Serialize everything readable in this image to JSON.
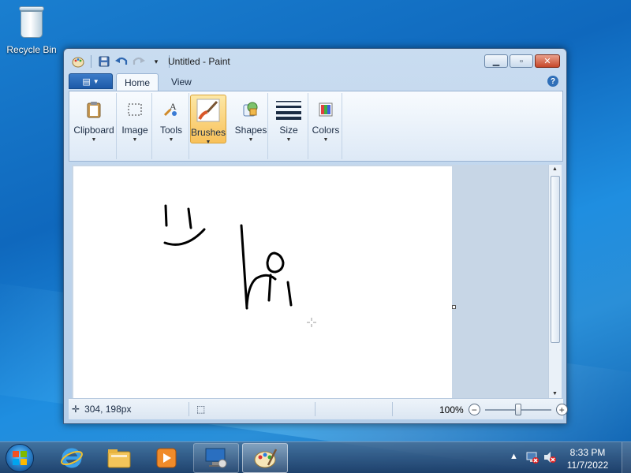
{
  "desktop": {
    "recycle_bin_label": "Recycle Bin"
  },
  "window": {
    "title": "Untitled - Paint",
    "qat_icons": [
      "paint-app-icon",
      "save-icon",
      "undo-icon",
      "redo-icon",
      "customize-qat-icon"
    ],
    "controls": [
      "minimize",
      "maximize",
      "close"
    ]
  },
  "ribbon": {
    "file_menu_icon": "paint-menu-icon",
    "tabs": [
      {
        "label": "Home",
        "active": true
      },
      {
        "label": "View",
        "active": false
      }
    ],
    "groups": [
      {
        "label": "Clipboard",
        "icon": "clipboard-icon"
      },
      {
        "label": "Image",
        "icon": "select-icon"
      },
      {
        "label": "Tools",
        "icon": "tools-icon"
      },
      {
        "label": "Brushes",
        "icon": "brush-icon",
        "selected": true
      },
      {
        "label": "Shapes",
        "icon": "shapes-icon"
      },
      {
        "label": "Size",
        "icon": "size-icon"
      },
      {
        "label": "Colors",
        "icon": "colors-icon"
      }
    ]
  },
  "statusbar": {
    "cursor_position": "304, 198px",
    "zoom": "100%"
  },
  "taskbar": {
    "pinned": [
      "internet-explorer-icon",
      "windows-explorer-icon",
      "media-player-icon",
      "remote-desktop-icon",
      "paint-icon"
    ],
    "clock_time": "8:33 PM",
    "clock_date": "11/7/2022"
  },
  "colors": {
    "accent": "#1d59a8",
    "selected_group": "#f8c15a"
  }
}
